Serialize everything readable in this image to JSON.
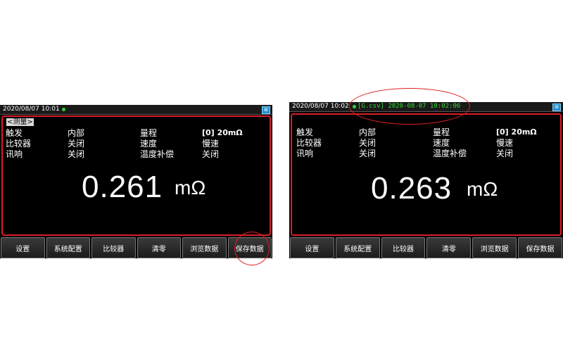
{
  "colors": {
    "screen_border": "#d81e2a",
    "status_green": "#3bd63b",
    "highlight": "#e02020"
  },
  "left_panel": {
    "status": {
      "datetime": "2020/08/07   10:01",
      "usb_icon": "usb-icon"
    },
    "mode_tag": "<测量>",
    "params": {
      "trigger_label": "触发",
      "trigger_value": "内部",
      "comparator_label": "比较器",
      "comparator_value": "关闭",
      "beep_label": "讯响",
      "beep_value": "关闭",
      "range_label": "量程",
      "range_value": "[0] 20mΩ",
      "speed_label": "速度",
      "speed_value": "慢速",
      "temp_comp_label": "温度补偿",
      "temp_comp_value": "关闭"
    },
    "reading": {
      "value": "0.261",
      "unit": "mΩ"
    },
    "softkeys": [
      "设置",
      "系统配置",
      "比较器",
      "清零",
      "浏览数据",
      "保存数据"
    ]
  },
  "right_panel": {
    "status": {
      "datetime": "2020/08/07   10:02",
      "save_message": "[G.csv]  2020-08-07  10:02:06",
      "usb_icon": "usb-icon"
    },
    "params": {
      "trigger_label": "触发",
      "trigger_value": "内部",
      "comparator_label": "比较器",
      "comparator_value": "关闭",
      "beep_label": "讯响",
      "beep_value": "关闭",
      "range_label": "量程",
      "range_value": "[0] 20mΩ",
      "speed_label": "速度",
      "speed_value": "慢速",
      "temp_comp_label": "温度补偿",
      "temp_comp_value": "关闭"
    },
    "reading": {
      "value": "0.263",
      "unit": "mΩ"
    },
    "softkeys": [
      "设置",
      "系统配置",
      "比较器",
      "清零",
      "浏览数据",
      "保存数据"
    ]
  }
}
